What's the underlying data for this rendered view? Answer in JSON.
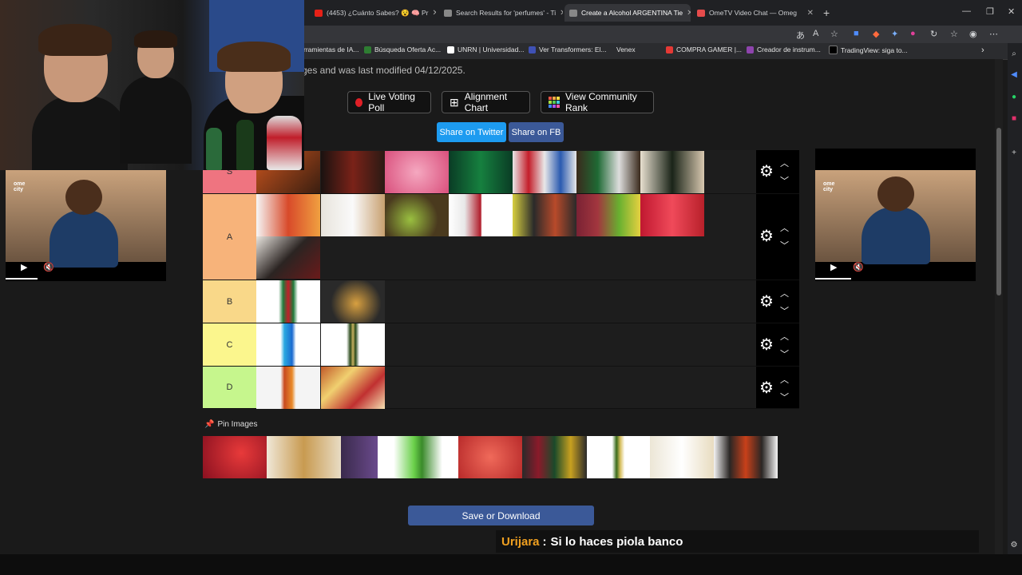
{
  "browser": {
    "tabs": [
      {
        "label": "(4453) ¿Cuánto Sabes? 😵 🧠 Pr",
        "fav": "#e62117"
      },
      {
        "label": "Search Results for 'perfumes' - Ti",
        "fav": "#888888"
      },
      {
        "label": "Create a Alcohol ARGENTINA Tie",
        "fav": "#888888",
        "active": true
      },
      {
        "label": "OmeTV Video Chat — Omeg",
        "fav": "#e54b4b"
      }
    ],
    "new_tab_label": "+",
    "bookmarks": [
      {
        "label": "rramientas de IA...",
        "fav": "#5a5a5a"
      },
      {
        "label": "Búsqueda Oferta Ac...",
        "fav": "#2e7d32"
      },
      {
        "label": "UNRN | Universidad...",
        "fav": "#ffffff"
      },
      {
        "label": "Ver Transformers: El...",
        "fav": "#3f51b5"
      },
      {
        "label": "Venex",
        "fav": "#1a1a1a"
      },
      {
        "label": "COMPRA GAMER |...",
        "fav": "#e53935"
      },
      {
        "label": "Creador de instrum...",
        "fav": "#8e44ad"
      },
      {
        "label": "TradingView: siga to...",
        "fav": "#000000"
      }
    ]
  },
  "page": {
    "modified_note": "ges and was last modified 04/12/2025.",
    "buttons": {
      "live_voting": "Live Voting Poll",
      "alignment": "Alignment Chart",
      "community": "View Community Rank",
      "share_twitter": "Share on Twitter",
      "share_fb": "Share on FB"
    },
    "tiers": [
      {
        "label": "S",
        "color": "#ef7480",
        "images": [
          "#6b3a22",
          "#2a1d18",
          "#e07090",
          "#0b5e3a",
          "#d9d9d9",
          "#4a6a3a",
          "#e8e0d0"
        ]
      },
      {
        "label": "A",
        "color": "#f7b37a",
        "images": [
          "#d84a2a",
          "#f0ede6",
          "#4a3a1e",
          "#f4f4f4",
          "#2a2a2a",
          "#a2363e",
          "#e2505a",
          "#2b2422"
        ]
      },
      {
        "label": "B",
        "color": "#f9d889",
        "images": [
          "#f2f2f2",
          "#2a2a2a"
        ]
      },
      {
        "label": "C",
        "color": "#fbf68d",
        "images": [
          "#ffffff",
          "#ffffff"
        ]
      },
      {
        "label": "D",
        "color": "#c6f68d",
        "images": [
          "#f4f4f4",
          "#c25a2a"
        ]
      }
    ],
    "pin_label": "Pin Images",
    "pin_images": [
      "#b01c2a",
      "#e8dcc4",
      "#4a3a5c",
      "#6ad04a",
      "#d84a3a",
      "#2a2a2a",
      "#f4f4f4",
      "#ece6d6",
      "#2a2624"
    ],
    "save_label": "Save or Download"
  },
  "chat": {
    "user": "Urijara",
    "separator": ":",
    "message": "Si lo haces piola banco"
  },
  "video": {
    "brand": "ome city"
  }
}
